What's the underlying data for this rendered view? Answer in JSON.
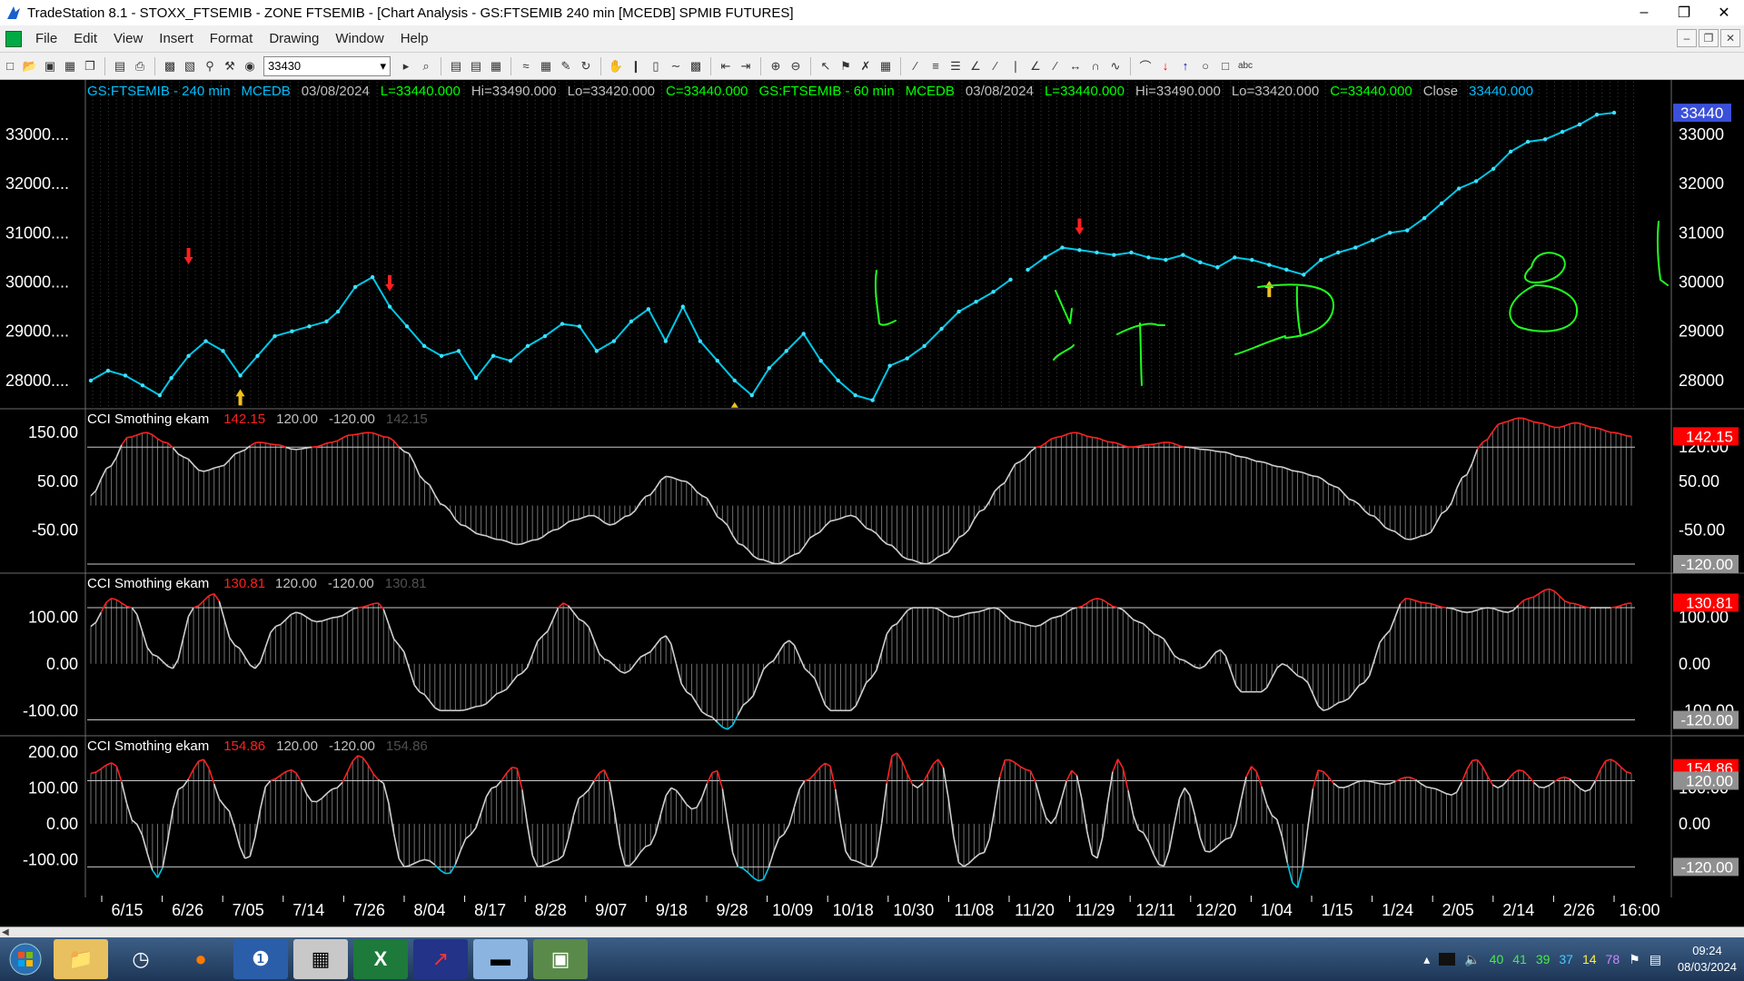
{
  "window": {
    "title": "TradeStation 8.1 - STOXX_FTSEMIB - ZONE FTSEMIB - [Chart Analysis - GS:FTSEMIB  240 min  [MCEDB] SPMIB FUTURES]",
    "minimize": "–",
    "restore": "❐",
    "close": "✕"
  },
  "menu": [
    "File",
    "Edit",
    "View",
    "Insert",
    "Format",
    "Drawing",
    "Window",
    "Help"
  ],
  "mdi_buttons": [
    "–",
    "❐",
    "✕"
  ],
  "toolbar": {
    "symbol_value": "33430"
  },
  "price_panel": {
    "header": [
      {
        "text": "GS:FTSEMIB - 240 min",
        "color": "#00bfff"
      },
      {
        "text": "MCEDB",
        "color": "#00bfff"
      },
      {
        "text": "03/08/2024",
        "color": "#c0c0c0"
      },
      {
        "text": "L=33440.000",
        "color": "#00ff00"
      },
      {
        "text": "Hi=33490.000",
        "color": "#c0c0c0"
      },
      {
        "text": "Lo=33420.000",
        "color": "#c0c0c0"
      },
      {
        "text": "C=33440.000",
        "color": "#00ff00"
      },
      {
        "text": "GS:FTSEMIB - 60 min",
        "color": "#00ff00"
      },
      {
        "text": "MCEDB",
        "color": "#00ff00"
      },
      {
        "text": "03/08/2024",
        "color": "#c0c0c0"
      },
      {
        "text": "L=33440.000",
        "color": "#00ff00"
      },
      {
        "text": "Hi=33490.000",
        "color": "#c0c0c0"
      },
      {
        "text": "Lo=33420.000",
        "color": "#c0c0c0"
      },
      {
        "text": "C=33440.000",
        "color": "#00ff00"
      },
      {
        "text": "Close",
        "color": "#c0c0c0"
      },
      {
        "text": "33440.000",
        "color": "#00bfff"
      }
    ],
    "left_axis": [
      "33000....",
      "32000....",
      "31000....",
      "30000....",
      "29000....",
      "28000...."
    ],
    "right_axis": [
      "33000",
      "32000",
      "31000",
      "30000",
      "29000",
      "28000"
    ],
    "last_price_tag": "33440"
  },
  "cci_panels": [
    {
      "title": "CCI Smothing ekam",
      "value": "142.15",
      "upper": "120.00",
      "lower": "-120.00",
      "value_dim": "142.15",
      "left_axis": [
        "150.00",
        "50.00",
        "-50.00"
      ],
      "right_axis": [
        "120.00",
        "50.00",
        "-50.00"
      ],
      "right_tags": [
        {
          "text": "142.15",
          "bg": "#ff0000"
        },
        {
          "text": "-120.00",
          "bg": "#909090"
        }
      ]
    },
    {
      "title": "CCI Smothing ekam",
      "value": "130.81",
      "upper": "120.00",
      "lower": "-120.00",
      "value_dim": "130.81",
      "left_axis": [
        "100.00",
        "0.00",
        "-100.00"
      ],
      "right_axis": [
        "100.00",
        "0.00",
        "-100.00"
      ],
      "right_tags": [
        {
          "text": "130.81",
          "bg": "#ff0000"
        },
        {
          "text": "-120.00",
          "bg": "#909090"
        }
      ]
    },
    {
      "title": "CCI Smothing ekam",
      "value": "154.86",
      "upper": "120.00",
      "lower": "-120.00",
      "value_dim": "154.86",
      "left_axis": [
        "200.00",
        "100.00",
        "0.00",
        "-100.00"
      ],
      "right_axis": [
        "100.00",
        "0.00",
        "-120.00"
      ],
      "right_tags": [
        {
          "text": "154.86",
          "bg": "#ff0000"
        },
        {
          "text": "120.00",
          "bg": "#909090"
        },
        {
          "text": "-120.00",
          "bg": "#909090"
        }
      ]
    }
  ],
  "time_axis": [
    "6/15",
    "6/26",
    "7/05",
    "7/14",
    "7/26",
    "8/04",
    "8/17",
    "8/28",
    "9/07",
    "9/18",
    "9/28",
    "10/09",
    "10/18",
    "10/30",
    "11/08",
    "11/20",
    "11/29",
    "12/11",
    "12/20",
    "1/04",
    "1/15",
    "1/24",
    "2/05",
    "2/14",
    "2/26",
    "16:00"
  ],
  "chart_data": {
    "type": "line",
    "series": [
      {
        "name": "GS:FTSEMIB - 240 min",
        "x_index": [
          0,
          3,
          6,
          9,
          12,
          14,
          17,
          20,
          23,
          26,
          29,
          32,
          35,
          38,
          41,
          43,
          46,
          49,
          52,
          55,
          58,
          61,
          64,
          67,
          70,
          73,
          76,
          79,
          82,
          85,
          88,
          91,
          94,
          97,
          100,
          103,
          106,
          109,
          112,
          115,
          118,
          121,
          124,
          127,
          130,
          133,
          136,
          139,
          142,
          145,
          148,
          151,
          154,
          157,
          160
        ],
        "values": [
          28000,
          28200,
          28100,
          27900,
          27700,
          28050,
          28500,
          28800,
          28600,
          28100,
          28500,
          28900,
          29000,
          29100,
          29200,
          29400,
          29900,
          30100,
          29500,
          29100,
          28700,
          28500,
          28600,
          28050,
          28500,
          28400,
          28700,
          28900,
          29150,
          29100,
          28600,
          28800,
          29200,
          29450,
          28800,
          29500,
          28800,
          28400,
          28000,
          27700,
          28250,
          28600,
          28950,
          28400,
          28000,
          27700,
          27600,
          28300,
          28450,
          28700,
          29050,
          29400,
          29600,
          29800,
          30050
        ]
      },
      {
        "name": "GS:FTSEMIB - 240 min (cont.)",
        "x_index": [
          163,
          166,
          169,
          172,
          175,
          178,
          181,
          184,
          187,
          190,
          193,
          196,
          199,
          202,
          205,
          208,
          211,
          214,
          217,
          220,
          223,
          226,
          229,
          232,
          235,
          238,
          241,
          244,
          247,
          250,
          253,
          256,
          259,
          262,
          265
        ],
        "values": [
          30250,
          30500,
          30700,
          30650,
          30600,
          30550,
          30600,
          30500,
          30450,
          30550,
          30400,
          30300,
          30500,
          30450,
          30350,
          30250,
          30150,
          30450,
          30600,
          30700,
          30850,
          31000,
          31050,
          31300,
          31600,
          31900,
          32050,
          32300,
          32650,
          32850,
          32900,
          33050,
          33200,
          33400,
          33440
        ]
      }
    ],
    "ylim": [
      27500,
      33700
    ],
    "cci": [
      {
        "name": "CCI Smothing ekam",
        "last": 142.15,
        "upper": 120,
        "lower": -120,
        "values": [
          20,
          80,
          140,
          150,
          130,
          100,
          70,
          80,
          110,
          130,
          125,
          115,
          120,
          130,
          145,
          150,
          140,
          110,
          50,
          0,
          -40,
          -60,
          -70,
          -80,
          -70,
          -50,
          -30,
          -20,
          -40,
          -20,
          20,
          60,
          50,
          20,
          -30,
          -80,
          -110,
          -120,
          -100,
          -60,
          -30,
          -20,
          -50,
          -80,
          -110,
          -120,
          -100,
          -60,
          -10,
          40,
          90,
          120,
          140,
          150,
          140,
          130,
          120,
          125,
          130,
          120,
          115,
          110,
          100,
          90,
          80,
          70,
          60,
          40,
          10,
          -20,
          -50,
          -70,
          -60,
          -10,
          60,
          130,
          170,
          180,
          170,
          160,
          170,
          160,
          150,
          142
        ]
      },
      {
        "name": "CCI Smothing ekam",
        "last": 130.81,
        "upper": 120,
        "lower": -120,
        "values": [
          80,
          140,
          120,
          20,
          -10,
          120,
          150,
          40,
          -10,
          80,
          110,
          90,
          100,
          120,
          130,
          40,
          -60,
          -100,
          -100,
          -90,
          -60,
          -20,
          60,
          130,
          90,
          10,
          -20,
          20,
          60,
          -60,
          -110,
          -140,
          -80,
          0,
          50,
          -20,
          -100,
          -100,
          -30,
          80,
          120,
          120,
          100,
          110,
          120,
          90,
          80,
          100,
          120,
          140,
          120,
          90,
          60,
          10,
          -10,
          30,
          -60,
          -60,
          0,
          -30,
          -100,
          -80,
          -40,
          60,
          140,
          130,
          120,
          110,
          120,
          110,
          140,
          160,
          130,
          120,
          120,
          130
        ]
      },
      {
        "name": "CCI Smothing ekam",
        "last": 154.86,
        "upper": 120,
        "lower": -120,
        "values": [
          140,
          170,
          0,
          -150,
          100,
          180,
          50,
          -100,
          120,
          150,
          60,
          100,
          190,
          120,
          -120,
          -100,
          -140,
          -30,
          100,
          160,
          -120,
          -100,
          80,
          150,
          -120,
          -60,
          100,
          40,
          150,
          -120,
          -160,
          -30,
          120,
          170,
          -100,
          -120,
          200,
          100,
          180,
          -120,
          -80,
          180,
          150,
          0,
          150,
          -100,
          180,
          -20,
          -120,
          100,
          -80,
          -40,
          160,
          20,
          -180,
          150,
          100,
          120,
          110,
          130,
          100,
          80,
          180,
          100,
          150,
          100,
          130,
          90,
          180,
          140
        ]
      }
    ]
  },
  "taskbar": {
    "tray_numbers": [
      {
        "text": "40",
        "color": "#44ee44"
      },
      {
        "text": "41",
        "color": "#44ee44"
      },
      {
        "text": "39",
        "color": "#44ee44"
      },
      {
        "text": "37",
        "color": "#44ccff"
      },
      {
        "text": "14",
        "color": "#ffee44"
      },
      {
        "text": "78",
        "color": "#cc88ff"
      }
    ],
    "time": "09:24",
    "date": "08/03/2024"
  }
}
